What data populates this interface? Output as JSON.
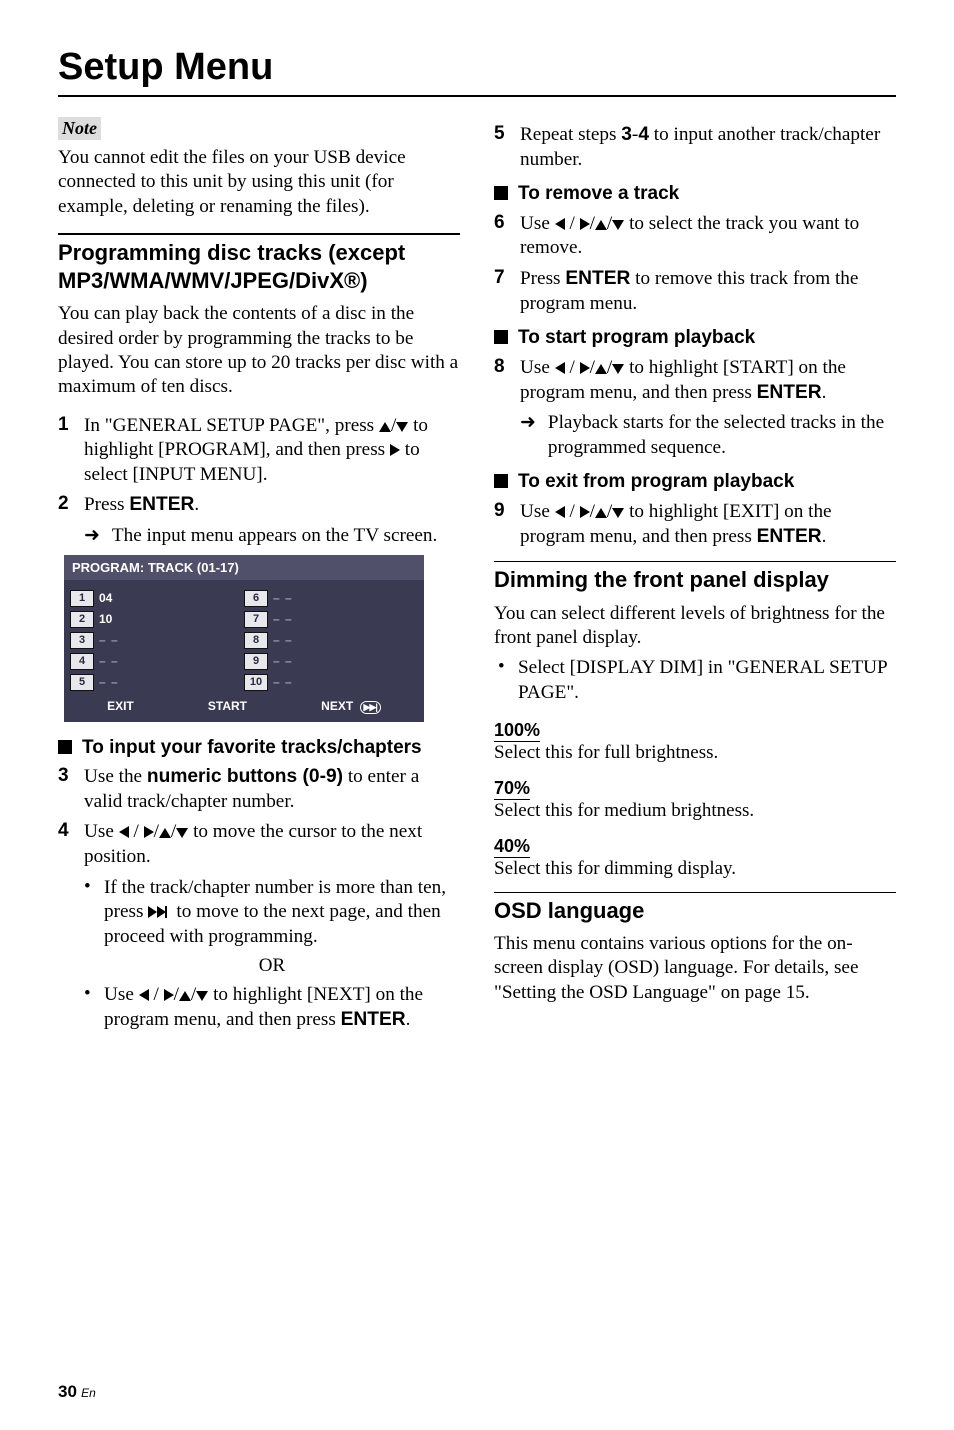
{
  "title": "Setup Menu",
  "note": {
    "label": "Note",
    "text": "You cannot edit the files on your USB device connected to this unit by using this unit (for example, deleting or renaming the files)."
  },
  "sec1": {
    "heading": "Programming disc tracks (except MP3/WMA/WMV/JPEG/DivX®)",
    "intro": "You can play back the contents of a disc in the desired order by programming the tracks to be played. You can store up to 20 tracks per disc with a maximum of ten discs.",
    "step1_a": "In \"GENERAL SETUP PAGE\", press ",
    "step1_b": " to highlight [PROGRAM], and then press ",
    "step1_c": " to select [INPUT MENU].",
    "step2_a": "Press ",
    "step2_b": ".",
    "step2_arrow": "The input menu appears on the TV screen.",
    "enter": "ENTER",
    "progmenu": {
      "title": "PROGRAM: TRACK (01-17)",
      "left": [
        {
          "n": "1",
          "v": "04"
        },
        {
          "n": "2",
          "v": "10"
        },
        {
          "n": "3",
          "v": "– –"
        },
        {
          "n": "4",
          "v": "– –"
        },
        {
          "n": "5",
          "v": "– –"
        }
      ],
      "right": [
        {
          "n": "6",
          "v": "– –"
        },
        {
          "n": "7",
          "v": "– –"
        },
        {
          "n": "8",
          "v": "– –"
        },
        {
          "n": "9",
          "v": "– –"
        },
        {
          "n": "10",
          "v": "– –"
        }
      ],
      "footer": {
        "exit": "EXIT",
        "start": "START",
        "next": "NEXT"
      }
    },
    "h3_input": "To input your favorite tracks/chapters",
    "step3_a": "Use the ",
    "step3_b": " to enter a valid track/chapter number.",
    "numeric": "numeric buttons (0-9)",
    "step4_a": "Use ",
    "step4_b": " to move the cursor to the next position.",
    "step4_bul1_a": "If the track/chapter number is more than ten, press ",
    "step4_bul1_b": " to move to the next page, and then proceed with programming.",
    "or": "OR",
    "step4_bul2_a": "Use ",
    "step4_bul2_b": " to highlight [NEXT] on the program menu, and then press ",
    "step4_bul2_c": "."
  },
  "right": {
    "step5_a": "Repeat steps ",
    "step5_b": " to input another track/chapter number.",
    "step5_bold34": "3-4",
    "h3_remove": "To remove a track",
    "step6_a": "Use ",
    "step6_b": " to select the track you want to remove.",
    "step7_a": "Press ",
    "step7_b": " to remove this track from the program menu.",
    "h3_start": "To start program playback",
    "step8_a": "Use ",
    "step8_b": " to highlight [START] on the program menu, and then press ",
    "step8_c": ".",
    "step8_arrow": "Playback starts for the selected tracks in the programmed sequence.",
    "h3_exit": "To exit from program playback",
    "step9_a": "Use ",
    "step9_b": " to highlight [EXIT] on the program menu, and then press ",
    "step9_c": "."
  },
  "dim": {
    "heading": "Dimming the front panel display",
    "intro": "You can select different levels of brightness for the front panel display.",
    "bullet": "Select [DISPLAY DIM] in \"GENERAL SETUP PAGE\".",
    "t1": "100%",
    "d1": "Select this for full brightness.",
    "t2": "70%",
    "d2": "Select this for medium brightness.",
    "t3": "40%",
    "d3": "Select this for dimming display."
  },
  "osd": {
    "heading": "OSD language",
    "text": "This menu contains various options for the on-screen display (OSD) language. For details, see \"Setting the OSD Language\" on page 15."
  },
  "pagenum": {
    "n": "30",
    "suf": "En"
  }
}
